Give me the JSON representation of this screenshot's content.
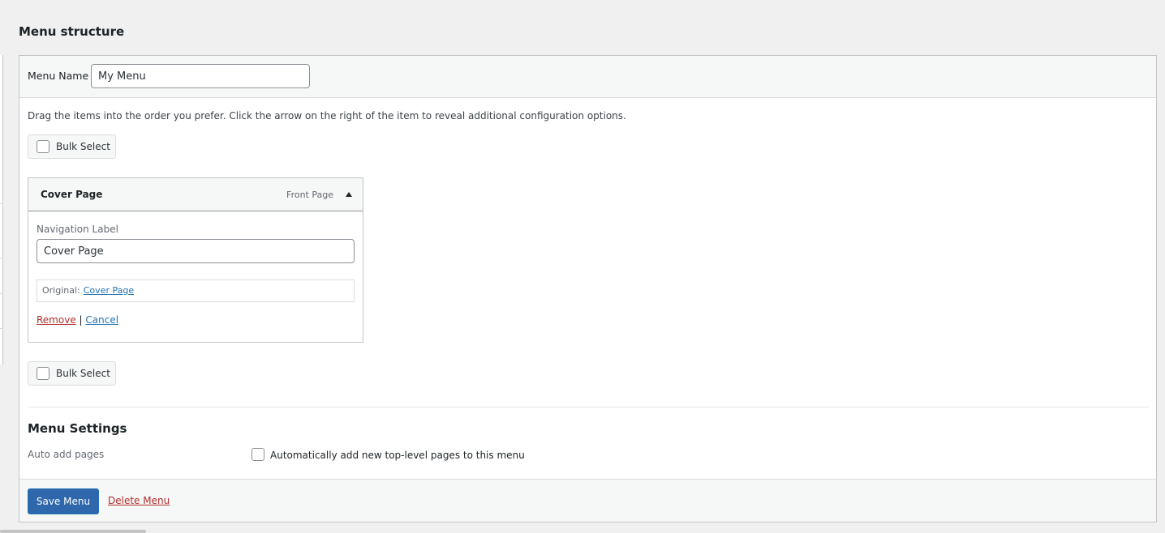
{
  "page_title": "Menu structure",
  "menu_name": {
    "label": "Menu Name",
    "value": "My Menu"
  },
  "instructions": "Drag the items into the order you prefer. Click the arrow on the right of the item to reveal additional configuration options.",
  "bulk_select_label": "Bulk Select",
  "menu_item": {
    "title": "Cover Page",
    "type": "Front Page",
    "navigation_label": {
      "label": "Navigation Label",
      "value": "Cover Page"
    },
    "original": {
      "label": "Original:",
      "link": "Cover Page"
    },
    "remove_label": "Remove",
    "separator": "|",
    "cancel_label": "Cancel"
  },
  "menu_settings": {
    "title": "Menu Settings",
    "auto_add_label": "Auto add pages",
    "auto_add_option": "Automatically add new top-level pages to this menu",
    "auto_add_checked": false
  },
  "footer": {
    "save_label": "Save Menu",
    "delete_label": "Delete Menu"
  },
  "colors": {
    "primary_button": "#2e67ab",
    "link": "#2271b1",
    "delete": "#b32d2e",
    "background": "#f0f0f1"
  },
  "icons": {
    "toggle": "triangle-up-icon",
    "checkbox": "checkbox-icon"
  }
}
